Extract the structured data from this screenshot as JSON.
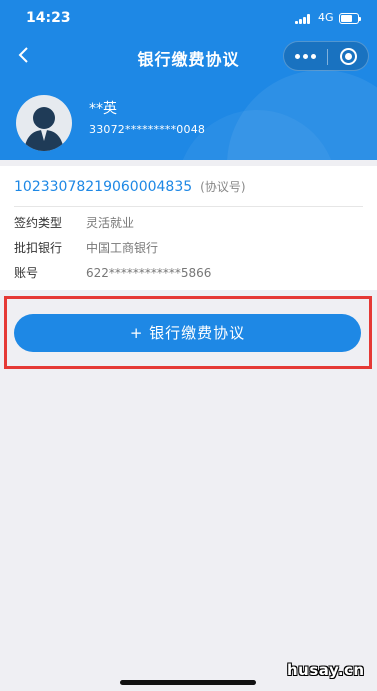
{
  "status_bar": {
    "time": "14:23",
    "network": "4G"
  },
  "nav": {
    "title": "银行缴费协议",
    "icons": [
      "back-arrow-icon",
      "more-dots-icon",
      "target-circle-icon"
    ]
  },
  "profile": {
    "name": "**英",
    "id_number": "33072*********0048",
    "avatar_icon": "person-avatar-icon"
  },
  "agreement": {
    "number": "10233078219060004835",
    "number_note": "(协议号)",
    "rows": [
      {
        "label": "签约类型",
        "value": "灵活就业"
      },
      {
        "label": "批扣银行",
        "value": "中国工商银行"
      },
      {
        "label": "账号",
        "value": "622************5866"
      }
    ]
  },
  "add_button": {
    "label": "+ 银行缴费协议"
  },
  "watermark": "husay.cn",
  "colors": {
    "primary": "#1e88e5",
    "highlight_border": "#e53935",
    "background": "#efeff3"
  }
}
